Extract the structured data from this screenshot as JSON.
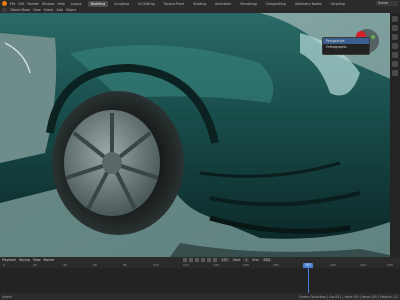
{
  "top_bar": {
    "menus": [
      "File",
      "Edit",
      "Render",
      "Window",
      "Help"
    ],
    "workspaces": [
      "Layout",
      "Modeling",
      "Sculpting",
      "UV Editing",
      "Texture Paint",
      "Shading",
      "Animation",
      "Rendering",
      "Compositing",
      "Geometry Nodes",
      "Scripting"
    ],
    "active_workspace": "Modeling",
    "scene_field": "Scene"
  },
  "viewport_header": {
    "mode": "Object Mode",
    "menus": [
      "View",
      "Select",
      "Add",
      "Object"
    ]
  },
  "popup": {
    "items": [
      "Perspective",
      "Orthographic"
    ],
    "selected": "Perspective"
  },
  "timeline_header": {
    "menus": [
      "Playback",
      "Keying",
      "View",
      "Marker"
    ],
    "current_frame": "107",
    "start_label": "Start",
    "start": "1",
    "end_label": "End",
    "end": "250"
  },
  "timeline": {
    "ticks": [
      "0",
      "20",
      "40",
      "60",
      "80",
      "100",
      "120",
      "140",
      "160",
      "180",
      "200",
      "220",
      "240"
    ],
    "playhead_frame": "107"
  },
  "status_bar": {
    "left": "Select",
    "right": "Scene Collection | Car.001 | Verts 0/0 | Faces 0/0 | Objects 1/1"
  },
  "colors": {
    "accent": "#4a7fd4",
    "logo": "#e87d0d",
    "gizmo_red": "#d4202a"
  }
}
